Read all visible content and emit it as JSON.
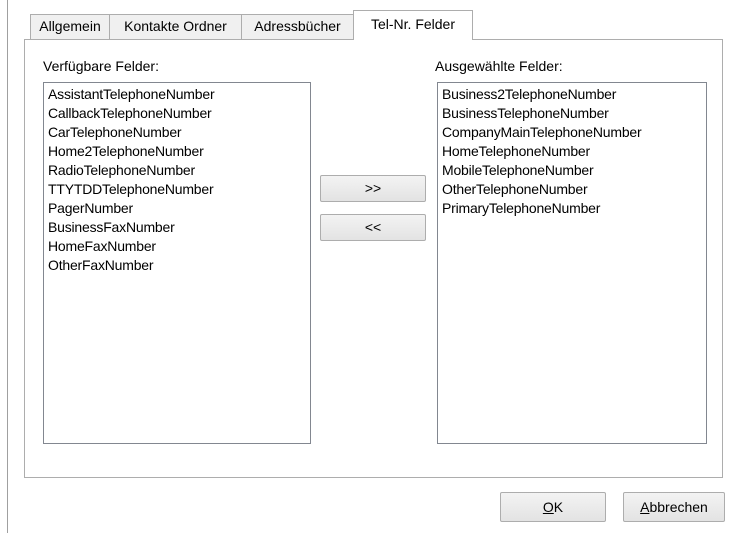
{
  "tabs": [
    {
      "label": "Allgemein",
      "active": false
    },
    {
      "label": "Kontakte Ordner",
      "active": false
    },
    {
      "label": "Adressbücher",
      "active": false
    },
    {
      "label": "Tel-Nr. Felder",
      "active": true
    }
  ],
  "available": {
    "caption": "Verfügbare Felder:",
    "items": [
      "AssistantTelephoneNumber",
      "CallbackTelephoneNumber",
      "CarTelephoneNumber",
      "Home2TelephoneNumber",
      "RadioTelephoneNumber",
      "TTYTDDTelephoneNumber",
      "PagerNumber",
      "BusinessFaxNumber",
      "HomeFaxNumber",
      "OtherFaxNumber"
    ]
  },
  "selected": {
    "caption": "Ausgewählte Felder:",
    "items": [
      "Business2TelephoneNumber",
      "BusinessTelephoneNumber",
      "CompanyMainTelephoneNumber",
      "HomeTelephoneNumber",
      "MobileTelephoneNumber",
      "OtherTelephoneNumber",
      "PrimaryTelephoneNumber"
    ]
  },
  "transfer": {
    "add_label": ">>",
    "remove_label": "<<"
  },
  "footer": {
    "ok_mnemonic": "O",
    "ok_rest": "K",
    "cancel_mnemonic": "A",
    "cancel_rest": "bbrechen"
  },
  "colors": {
    "tab_background": "#f0f0f0",
    "border": "#adadad",
    "list_border": "#828790"
  }
}
